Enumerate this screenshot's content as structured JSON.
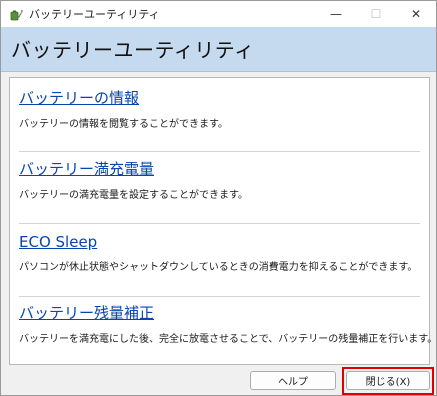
{
  "window": {
    "title": "バッテリーユーティリティ",
    "minimize_glyph": "—",
    "maximize_glyph": "☐",
    "close_glyph": "✕"
  },
  "header": {
    "title": "バッテリーユーティリティ"
  },
  "sections": [
    {
      "link": "バッテリーの情報",
      "description": "バッテリーの情報を閲覧することができます。"
    },
    {
      "link": "バッテリー満充電量",
      "description": "バッテリーの満充電量を設定することができます。"
    },
    {
      "link": "ECO Sleep",
      "description": "パソコンが休止状態やシャットダウンしているときの消費電力を抑えることができます。"
    },
    {
      "link": "バッテリー残量補正",
      "description": "バッテリーを満充電にした後、完全に放電させることで、バッテリーの残量補正を行います。"
    }
  ],
  "footer": {
    "help_label": "ヘルプ",
    "close_label": "閉じる(X)"
  },
  "colors": {
    "header_background": "#c5d9ef",
    "link": "#0645ad",
    "highlight": "#e00000"
  },
  "icons": {
    "app": "battery-utility-app-icon"
  }
}
